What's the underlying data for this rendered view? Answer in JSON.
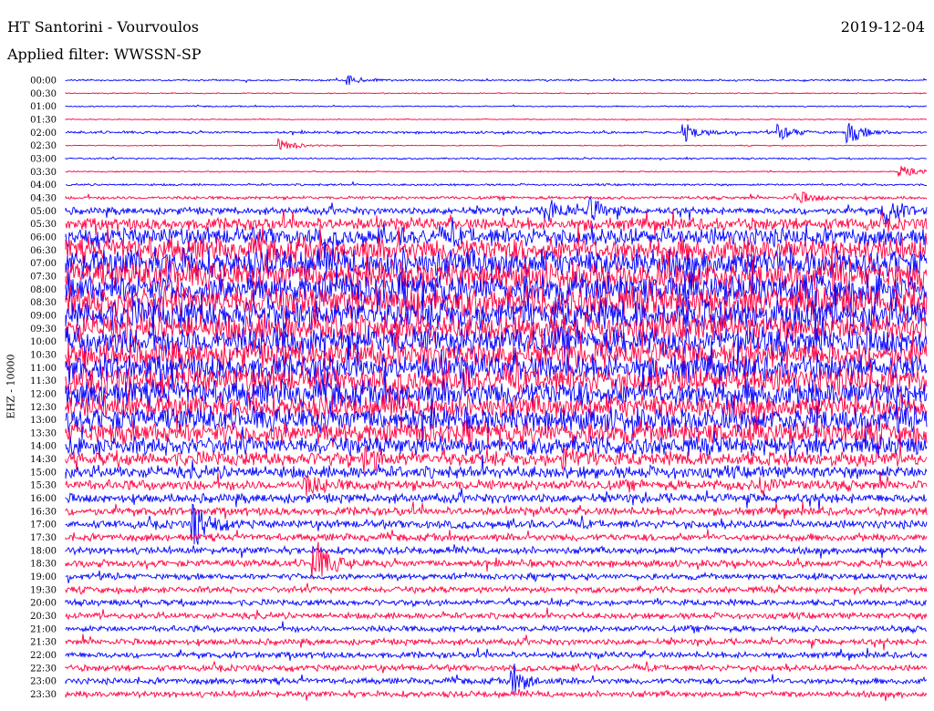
{
  "header": {
    "station": "HT Santorini - Vourvoulos",
    "date": "2019-12-04",
    "filter_label": "Applied filter: WWSSN-SP",
    "channel_label": "EHZ - 10000"
  },
  "colors": {
    "trace_a": "#0000ff",
    "trace_b": "#ff0040",
    "background": "#ffffff"
  },
  "chart_data": {
    "type": "helicorder",
    "title": "HT Santorini - Vourvoulos",
    "subtitle": "Applied filter: WWSSN-SP",
    "ylabel": "EHZ - 10000",
    "row_labels": [
      "00:00",
      "00:30",
      "01:00",
      "01:30",
      "02:00",
      "02:30",
      "03:00",
      "03:30",
      "04:00",
      "04:30",
      "05:00",
      "05:30",
      "06:00",
      "06:30",
      "07:00",
      "07:30",
      "08:00",
      "08:30",
      "09:00",
      "09:30",
      "10:00",
      "10:30",
      "11:00",
      "11:30",
      "12:00",
      "12:30",
      "13:00",
      "13:30",
      "14:00",
      "14:30",
      "15:00",
      "15:30",
      "16:00",
      "16:30",
      "17:00",
      "17:30",
      "18:00",
      "18:30",
      "19:00",
      "19:30",
      "20:00",
      "20:30",
      "21:00",
      "21:30",
      "22:00",
      "22:30",
      "23:00",
      "23:30"
    ],
    "series_colors": [
      "#0000ff",
      "#ff0040"
    ],
    "noise_amplitude": [
      0.08,
      0.05,
      0.06,
      0.05,
      0.12,
      0.05,
      0.08,
      0.06,
      0.1,
      0.15,
      0.35,
      0.6,
      0.9,
      1.2,
      1.4,
      1.4,
      1.5,
      1.5,
      1.5,
      1.4,
      1.4,
      1.3,
      1.3,
      1.3,
      1.3,
      1.2,
      1.2,
      1.1,
      0.9,
      0.7,
      0.6,
      0.5,
      0.45,
      0.4,
      0.4,
      0.35,
      0.35,
      0.35,
      0.3,
      0.3,
      0.3,
      0.3,
      0.3,
      0.3,
      0.3,
      0.3,
      0.3,
      0.3
    ],
    "events": [
      {
        "row": 0,
        "time": 0.33,
        "amp": 0.5
      },
      {
        "row": 4,
        "time": 0.72,
        "amp": 1.0
      },
      {
        "row": 4,
        "time": 0.83,
        "amp": 0.9
      },
      {
        "row": 4,
        "time": 0.91,
        "amp": 1.3
      },
      {
        "row": 5,
        "time": 0.25,
        "amp": 0.8
      },
      {
        "row": 7,
        "time": 0.97,
        "amp": 0.7
      },
      {
        "row": 9,
        "time": 0.85,
        "amp": 0.8
      },
      {
        "row": 10,
        "time": 0.56,
        "amp": 1.5
      },
      {
        "row": 10,
        "time": 0.61,
        "amp": 1.2
      },
      {
        "row": 10,
        "time": 0.95,
        "amp": 1.6
      },
      {
        "row": 29,
        "time": 0.35,
        "amp": 1.2
      },
      {
        "row": 29,
        "time": 0.58,
        "amp": 1.0
      },
      {
        "row": 31,
        "time": 0.28,
        "amp": 1.0
      },
      {
        "row": 31,
        "time": 0.81,
        "amp": 1.0
      },
      {
        "row": 34,
        "time": 0.15,
        "amp": 2.4
      },
      {
        "row": 37,
        "time": 0.29,
        "amp": 2.6
      },
      {
        "row": 46,
        "time": 0.52,
        "amp": 1.5
      }
    ]
  }
}
